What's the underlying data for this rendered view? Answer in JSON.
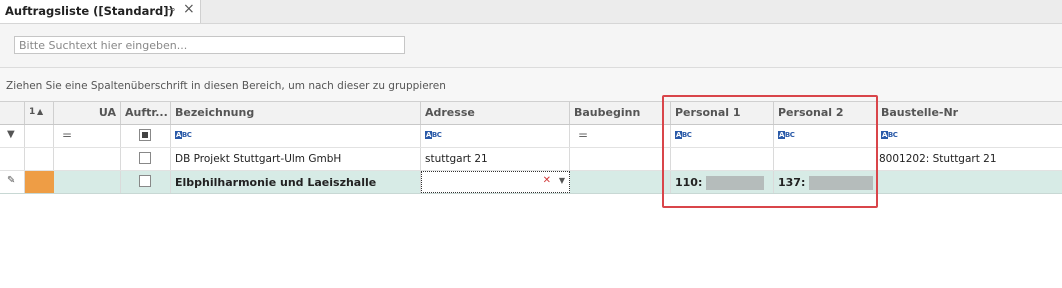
{
  "tab": {
    "title": "Auftragsliste ([Standard])"
  },
  "search": {
    "placeholder": "Bitte Suchtext hier eingeben..."
  },
  "group_panel": {
    "hint": "Ziehen Sie eine Spaltenüberschrift in diesen Bereich, um nach dieser zu gruppieren"
  },
  "columns": {
    "sort_index": "1",
    "ua": "UA",
    "auftr": "Auftr...",
    "bezeichnung": "Bezeichnung",
    "adresse": "Adresse",
    "baubeginn": "Baubeginn",
    "personal1": "Personal 1",
    "personal2": "Personal 2",
    "baustelle": "Baustelle-Nr"
  },
  "rows": [
    {
      "bezeichnung": "DB Projekt Stuttgart-Ulm GmbH",
      "adresse": "stuttgart 21",
      "personal1": "",
      "personal2": "",
      "baustelle": "8001202: Stuttgart 21"
    },
    {
      "bezeichnung": "Elbphilharmonie und Laeiszhalle",
      "adresse": "",
      "personal1": "110:",
      "personal2": "137:",
      "baustelle": ""
    }
  ],
  "colors": {
    "highlight": "#d9454a",
    "selected_row": "#d7ebe6",
    "row_indicator": "#ee9d45"
  }
}
